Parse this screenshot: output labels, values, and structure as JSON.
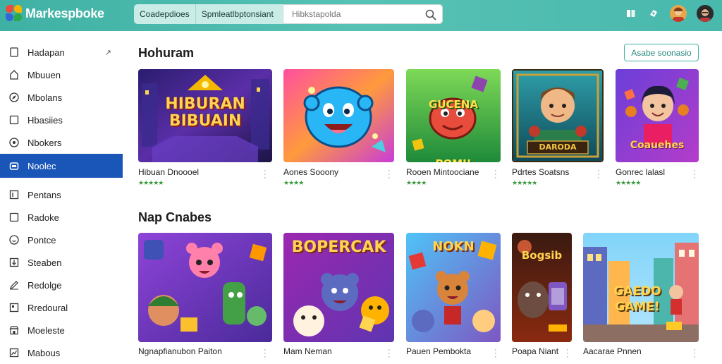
{
  "app": {
    "name": "Markespboke"
  },
  "search": {
    "tab1": "Coadepdioes",
    "tab2": "Spmleatlbptonsiant",
    "placeholder": "Hibkstapolda"
  },
  "sidebar": {
    "items": [
      {
        "label": "Hadapan",
        "icon": "page-icon"
      },
      {
        "label": "Mbuuen",
        "icon": "home-icon"
      },
      {
        "label": "Mbolans",
        "icon": "compass-icon"
      },
      {
        "label": "Hbasiies",
        "icon": "square-icon"
      },
      {
        "label": "Nbokers",
        "icon": "disc-icon"
      },
      {
        "label": "Noolec",
        "icon": "bag-icon"
      },
      {
        "label": "Pentans",
        "icon": "list-icon"
      },
      {
        "label": "Radoke",
        "icon": "box-icon"
      },
      {
        "label": "Pontce",
        "icon": "smile-icon"
      },
      {
        "label": "Steaben",
        "icon": "download-icon"
      },
      {
        "label": "Redolge",
        "icon": "pencil-icon"
      },
      {
        "label": "Rredoural",
        "icon": "book-icon"
      },
      {
        "label": "Moeleste",
        "icon": "store-icon"
      },
      {
        "label": "Mabous",
        "icon": "chart-icon"
      }
    ],
    "active_index": 5
  },
  "sections": [
    {
      "title": "Hohuram",
      "see_more": "Asabe soonasio",
      "cards": [
        {
          "title": "Hibuan Dnoooel",
          "stars": "★★★★★",
          "art_text": "HIBURAN BIBUAIN"
        },
        {
          "title": "Aones Sooony",
          "stars": "★★★★"
        },
        {
          "title": "Rooen Mintoociane",
          "stars": "★★★★",
          "art_text": "GUCENA POMI!"
        },
        {
          "title": "Pdrtes Soatsns",
          "stars": "★★★★★",
          "art_text": "DARODA"
        },
        {
          "title": "Gonrec lalasl",
          "stars": "★★★★★",
          "art_text": "Coauehes"
        }
      ]
    },
    {
      "title": "Nap Cnabes",
      "cards": [
        {
          "title": "Ngnapfianubon Paiton"
        },
        {
          "title": "Mam Neman",
          "art_text": "BOPERCAK"
        },
        {
          "title": "Pauen Pembokta",
          "art_text": "NOKN"
        },
        {
          "title": "Poapa Niant",
          "art_text": "Bogsib"
        },
        {
          "title": "Aacarae Pnnen",
          "art_text": "GAEDO GAME!"
        }
      ]
    }
  ],
  "colors": {
    "topbar": "#4bb9ad",
    "active_sidebar": "#1a56b8",
    "stars": "#3a9a3e"
  }
}
